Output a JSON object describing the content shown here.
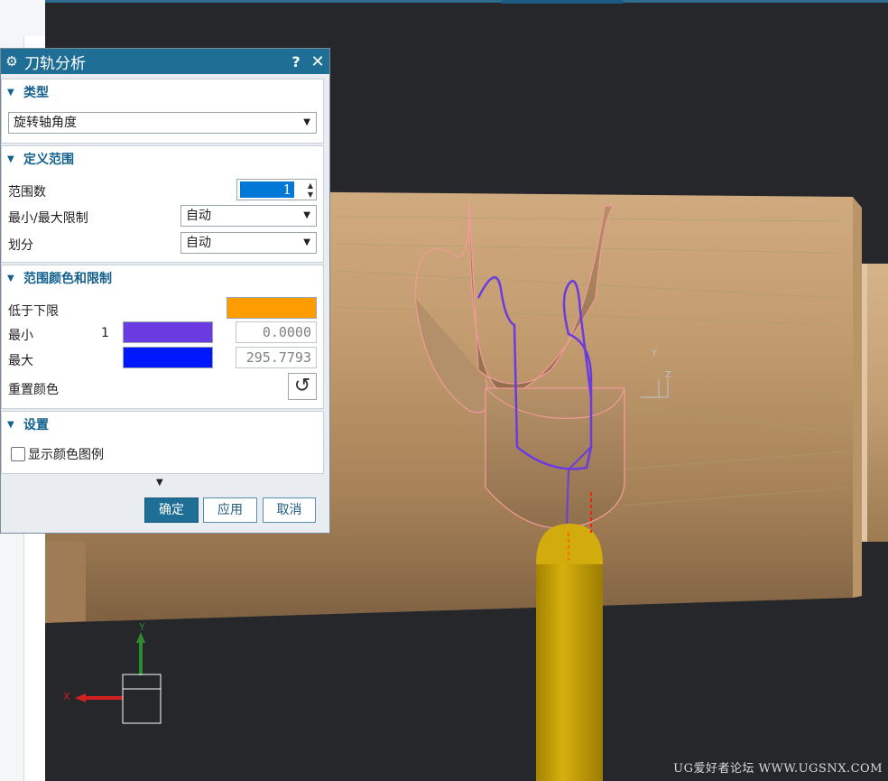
{
  "dialog": {
    "title": "刀轨分析",
    "help": "?",
    "close": "✕",
    "sections": {
      "type": {
        "header": "类型",
        "select_value": "旋转轴角度"
      },
      "range": {
        "header": "定义范围",
        "count_label": "范围数",
        "count_value": "1",
        "minmax_label": "最小/最大限制",
        "minmax_value": "自动",
        "division_label": "划分",
        "division_value": "自动"
      },
      "colors": {
        "header": "范围颜色和限制",
        "below_label": "低于下限",
        "below_color": "#ff9c00",
        "min_label": "最小",
        "range_index": "1",
        "min_color": "#6a3be0",
        "min_value": "0.0000",
        "max_label": "最大",
        "max_color": "#0018ff",
        "max_value": "295.7793",
        "reset_label": "重置颜色"
      },
      "settings": {
        "header": "设置",
        "show_legend_label": "显示颜色图例",
        "show_legend_checked": false
      }
    },
    "buttons": {
      "ok": "确定",
      "apply": "应用",
      "cancel": "取消"
    }
  },
  "viewport": {
    "triad": {
      "x_label": "X",
      "y_label": "Y"
    },
    "wcs": {
      "y_label": "Y",
      "z_label": "Z"
    },
    "watermark": "UG爱好者论坛 WWW.UGSNX.COM"
  }
}
